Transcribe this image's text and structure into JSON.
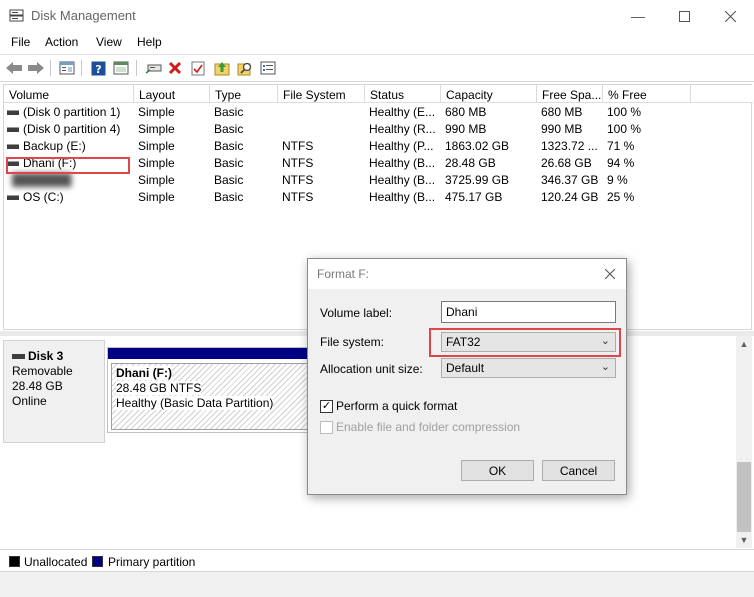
{
  "window": {
    "title": "Disk Management"
  },
  "menu": {
    "items": [
      "File",
      "Action",
      "View",
      "Help"
    ]
  },
  "toolbar": {
    "icons": [
      "back-arrow-icon",
      "forward-arrow-icon",
      "properties-icon",
      "help-icon",
      "show-hide-icon",
      "connect-icon",
      "delete-icon",
      "check-icon",
      "import-icon",
      "search-icon",
      "list-icon"
    ]
  },
  "volume_table": {
    "columns": [
      "Volume",
      "Layout",
      "Type",
      "File System",
      "Status",
      "Capacity",
      "Free Spa...",
      "% Free"
    ],
    "rows": [
      {
        "volume": "(Disk 0 partition 1)",
        "layout": "Simple",
        "type": "Basic",
        "fs": "",
        "status": "Healthy (E...",
        "capacity": "680 MB",
        "free": "680 MB",
        "pct": "100 %"
      },
      {
        "volume": "(Disk 0 partition 4)",
        "layout": "Simple",
        "type": "Basic",
        "fs": "",
        "status": "Healthy (R...",
        "capacity": "990 MB",
        "free": "990 MB",
        "pct": "100 %"
      },
      {
        "volume": "Backup (E:)",
        "layout": "Simple",
        "type": "Basic",
        "fs": "NTFS",
        "status": "Healthy (P...",
        "capacity": "1863.02 GB",
        "free": "1323.72 ...",
        "pct": "71 %"
      },
      {
        "volume": "Dhani (F:)",
        "layout": "Simple",
        "type": "Basic",
        "fs": "NTFS",
        "status": "Healthy (B...",
        "capacity": "28.48 GB",
        "free": "26.68 GB",
        "pct": "94 %"
      },
      {
        "volume": "███████",
        "layout": "Simple",
        "type": "Basic",
        "fs": "NTFS",
        "status": "Healthy (B...",
        "capacity": "3725.99 GB",
        "free": "346.37 GB",
        "pct": "9 %"
      },
      {
        "volume": "OS (C:)",
        "layout": "Simple",
        "type": "Basic",
        "fs": "NTFS",
        "status": "Healthy (B...",
        "capacity": "475.17 GB",
        "free": "120.24 GB",
        "pct": "25 %"
      }
    ]
  },
  "disk": {
    "name": "Disk 3",
    "kind": "Removable",
    "size": "28.48 GB",
    "state": "Online",
    "partition": {
      "title": "Dhani  (F:)",
      "size_fs": "28.48 GB NTFS",
      "status": "Healthy (Basic Data Partition)"
    }
  },
  "legend": {
    "unallocated": "Unallocated",
    "primary": "Primary partition",
    "unallocated_color": "#000000",
    "primary_color": "#000084"
  },
  "dialog": {
    "title": "Format F:",
    "volume_label_label": "Volume label:",
    "volume_label_value": "Dhani",
    "file_system_label": "File system:",
    "file_system_value": "FAT32",
    "alloc_label": "Allocation unit size:",
    "alloc_value": "Default",
    "quick_format": "Perform a quick format",
    "compression": "Enable file and folder compression",
    "ok": "OK",
    "cancel": "Cancel"
  },
  "highlight_color": "#e0454c"
}
